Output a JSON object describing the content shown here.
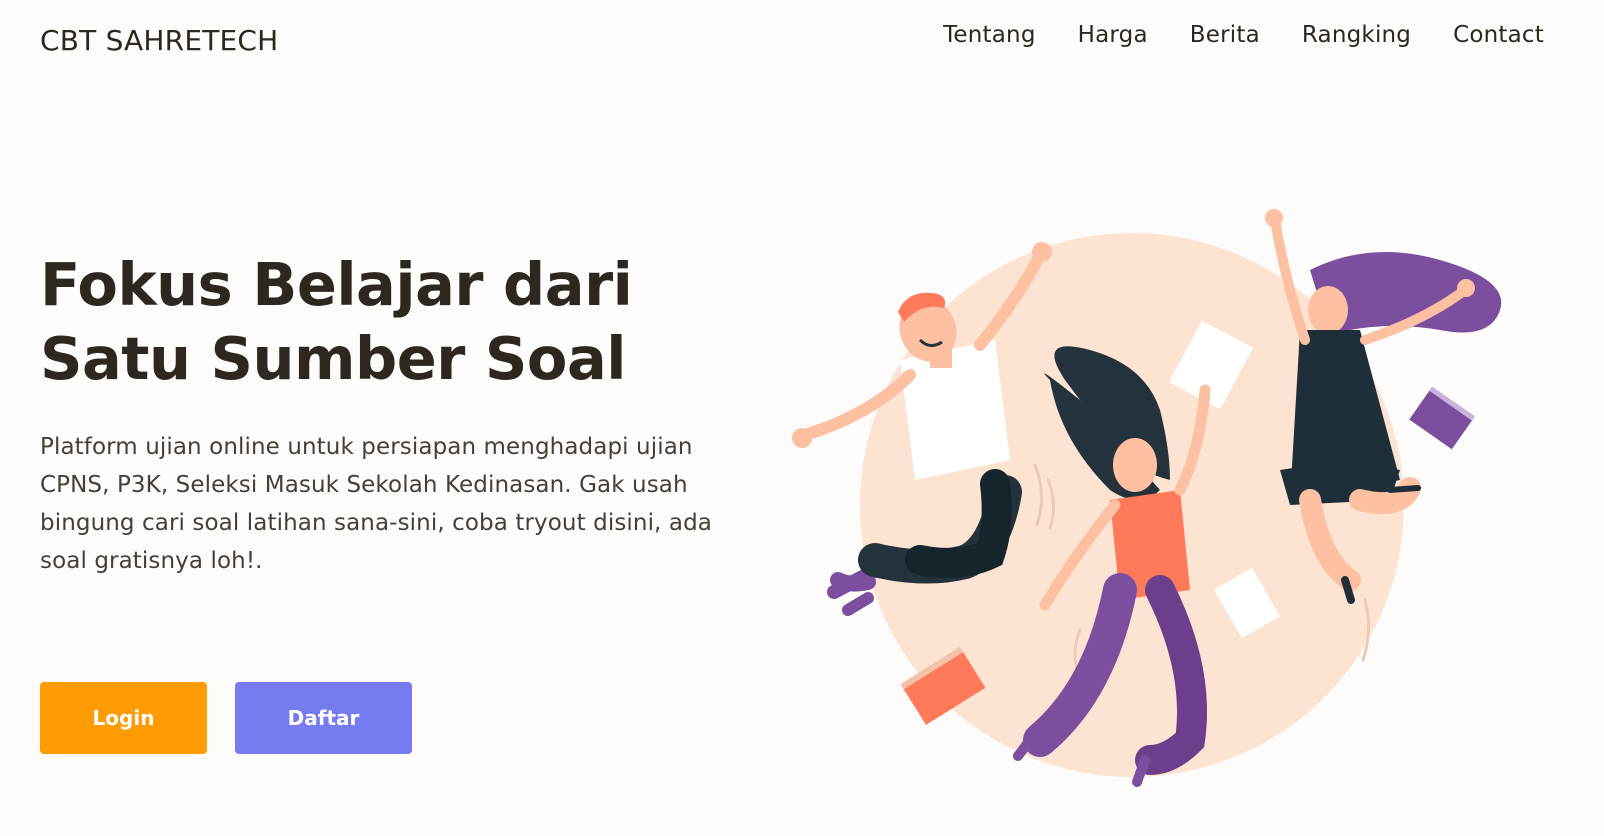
{
  "brand": {
    "name": "CBT SAHRETECH"
  },
  "nav": {
    "items": [
      {
        "label": "Tentang"
      },
      {
        "label": "Harga"
      },
      {
        "label": "Berita"
      },
      {
        "label": "Rangking"
      },
      {
        "label": "Contact"
      }
    ]
  },
  "hero": {
    "title_line1": "Fokus Belajar dari",
    "title_line2": "Satu Sumber Soal",
    "description": "Platform ujian online untuk persiapan menghadapi ujian CPNS, P3K, Seleksi Masuk Sekolah Kedinasan. Gak usah bingung cari soal latihan sana-sini, coba tryout disini, ada soal gratisnya loh!.",
    "login_label": "Login",
    "daftar_label": "Daftar"
  },
  "colors": {
    "text": "#2e271f",
    "login_button": "#ff9c03",
    "daftar_button": "#767cf0",
    "illustration_circle": "#fde4d2",
    "purple": "#7b4f9e",
    "coral": "#ff7a5a",
    "dark": "#1f2f3a"
  },
  "illustration": {
    "icon": "jumping-people-illustration"
  }
}
